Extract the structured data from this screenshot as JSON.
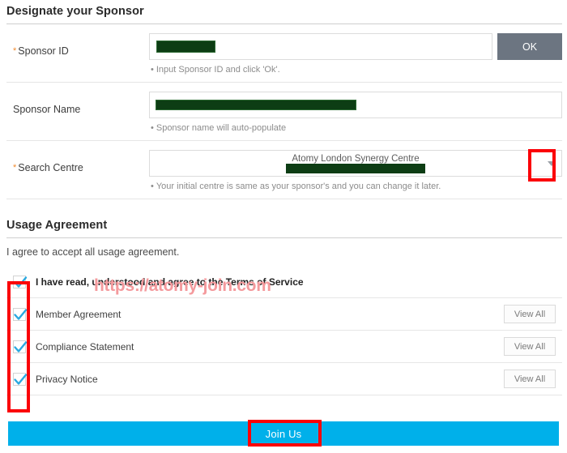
{
  "sponsor_section": {
    "title": "Designate your Sponsor",
    "rows": [
      {
        "label": "Sponsor ID",
        "required": true,
        "required_mark": "*",
        "hint": "Input Sponsor ID and click 'Ok'.",
        "hint_bullet": "•",
        "value": "",
        "redacted": true,
        "button_label": "OK"
      },
      {
        "label": "Sponsor Name",
        "required": false,
        "required_mark": "",
        "hint": "Sponsor name will auto-populate",
        "hint_bullet": "•",
        "value": "",
        "redacted": true
      },
      {
        "label": "Search Centre",
        "required": true,
        "required_mark": "*",
        "hint": "Your initial centre is same as your sponsor's and you can change it later.",
        "hint_bullet": "•",
        "selected_option": "Atomy London Synergy Centre",
        "redacted": true
      }
    ]
  },
  "usage_section": {
    "title": "Usage Agreement",
    "lead_text": "I agree to accept all usage agreement.",
    "items": [
      {
        "label": "I have read, understood and agree to the Terms of Service",
        "checked": true,
        "emphasis": true,
        "has_view_all": false,
        "view_all_label": ""
      },
      {
        "label": "Member Agreement",
        "checked": true,
        "emphasis": false,
        "has_view_all": true,
        "view_all_label": "View All"
      },
      {
        "label": "Compliance Statement",
        "checked": true,
        "emphasis": false,
        "has_view_all": true,
        "view_all_label": "View All"
      },
      {
        "label": "Privacy Notice",
        "checked": true,
        "emphasis": false,
        "has_view_all": true,
        "view_all_label": "View All"
      }
    ]
  },
  "submit": {
    "label": "Join Us"
  },
  "watermark": {
    "text": "https://atomy-join.com"
  },
  "colors": {
    "accent_blue": "#00b0ea",
    "ok_button": "#6c7581",
    "highlight_red": "#fb0007",
    "required_orange": "#f08a2e",
    "checkbox_check": "#2aa9e0",
    "redaction_green": "#0d3d14",
    "watermark_pink": "#f49a9d"
  }
}
